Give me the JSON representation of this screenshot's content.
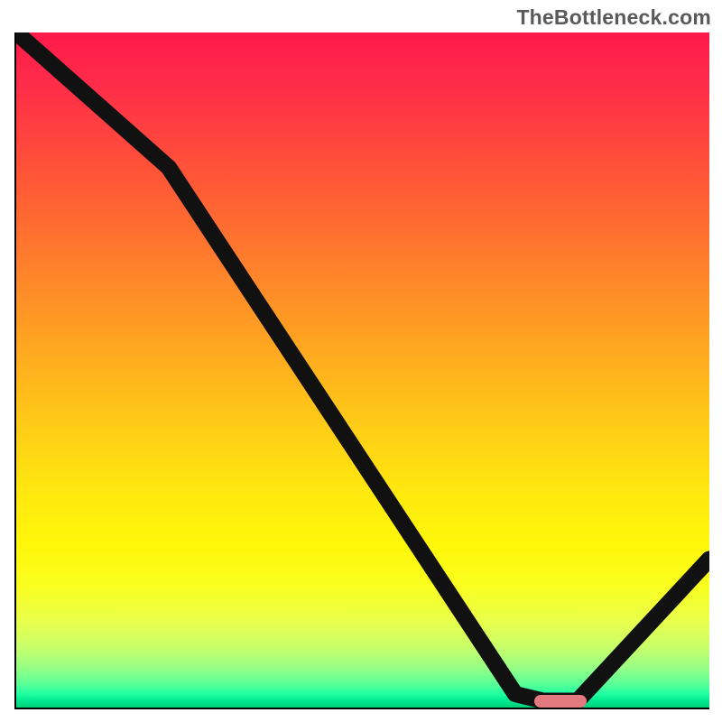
{
  "watermark": {
    "text": "TheBottleneck.com"
  },
  "chart_data": {
    "type": "line",
    "title": "",
    "xlabel": "",
    "ylabel": "",
    "xlim": [
      0,
      100
    ],
    "ylim": [
      0,
      100
    ],
    "x": [
      0,
      22,
      72,
      76,
      81,
      100
    ],
    "values": [
      100,
      80,
      2,
      1,
      1,
      22
    ],
    "marker": {
      "x_center": 78.5,
      "y": 1,
      "width_pct": 7.5
    },
    "background_gradient": {
      "stops": [
        {
          "pct": 0,
          "color": "#ff1a4b"
        },
        {
          "pct": 22,
          "color": "#ff5836"
        },
        {
          "pct": 46,
          "color": "#ffa521"
        },
        {
          "pct": 68,
          "color": "#ffe80f"
        },
        {
          "pct": 87,
          "color": "#eaff4a"
        },
        {
          "pct": 96,
          "color": "#5bff97"
        },
        {
          "pct": 100,
          "color": "#00d07a"
        }
      ]
    }
  }
}
